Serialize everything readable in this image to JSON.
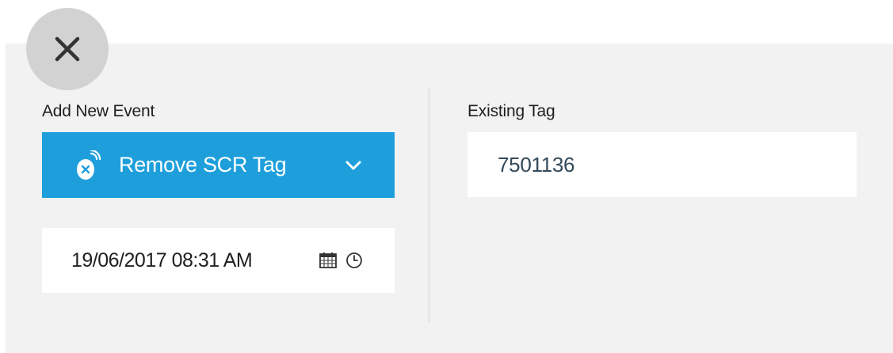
{
  "close_button": {
    "icon": "close-icon"
  },
  "add_event": {
    "label": "Add New Event",
    "selected_event": "Remove SCR Tag",
    "event_icon": "scr-tag-remove-icon",
    "dropdown_icon": "chevron-down-icon",
    "accent_color": "#1e9fdc"
  },
  "datetime": {
    "value": "19/06/2017 08:31 AM",
    "calendar_icon": "calendar-icon",
    "clock_icon": "clock-icon"
  },
  "existing_tag": {
    "label": "Existing Tag",
    "value": "7501136"
  }
}
